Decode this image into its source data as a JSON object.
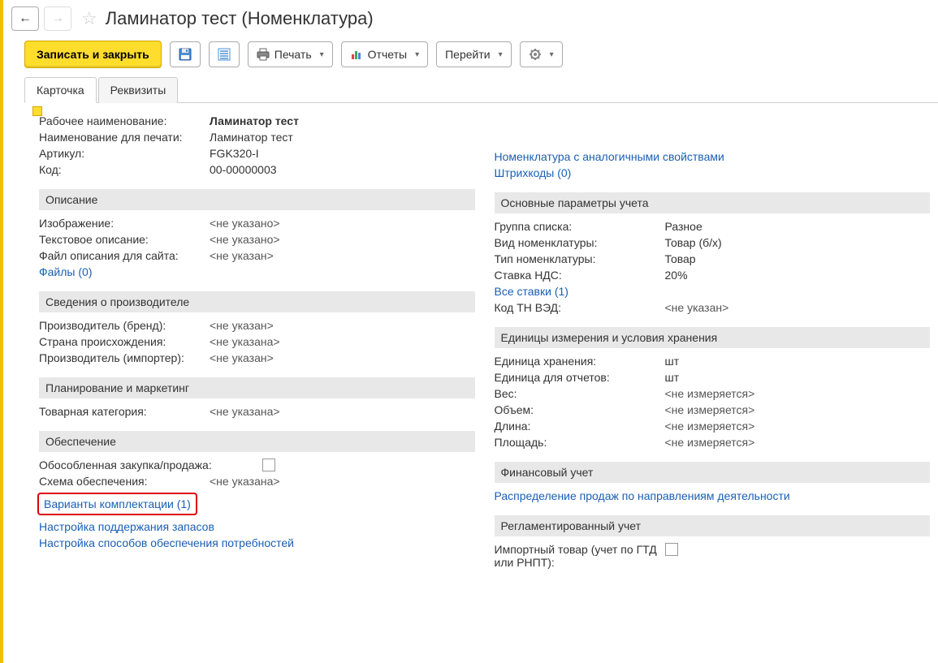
{
  "title": "Ламинатор тест (Номенклатура)",
  "toolbar": {
    "save_close": "Записать и закрыть",
    "print": "Печать",
    "reports": "Отчеты",
    "goto": "Перейти"
  },
  "tabs": {
    "card": "Карточка",
    "props": "Реквизиты"
  },
  "left": {
    "working_name_label": "Рабочее наименование:",
    "working_name": "Ламинатор тест",
    "print_name_label": "Наименование для печати:",
    "print_name": "Ламинатор тест",
    "article_label": "Артикул:",
    "article": "FGK320-I",
    "code_label": "Код:",
    "code": "00-00000003",
    "desc_header": "Описание",
    "image_label": "Изображение:",
    "image_val": "<не указано>",
    "text_desc_label": "Текстовое описание:",
    "text_desc_val": "<не указано>",
    "site_file_label": "Файл описания для сайта:",
    "site_file_val": "<не указан>",
    "files_link": "Файлы (0)",
    "manuf_header": "Сведения о производителе",
    "brand_label": "Производитель (бренд):",
    "brand_val": "<не указан>",
    "origin_label": "Страна происхождения:",
    "origin_val": "<не указана>",
    "importer_label": "Производитель (импортер):",
    "importer_val": "<не указан>",
    "planning_header": "Планирование и маркетинг",
    "cat_label": "Товарная категория:",
    "cat_val": "<не указана>",
    "supply_header": "Обеспечение",
    "separate_label": "Обособленная закупка/продажа:",
    "scheme_label": "Схема обеспечения:",
    "scheme_val": "<не указана>",
    "variants_link": "Варианты комплектации (1)",
    "stock_link": "Настройка поддержания запасов",
    "methods_link": "Настройка способов обеспечения потребностей"
  },
  "right": {
    "analog_link": "Номенклатура с аналогичными свойствами",
    "barcodes_link": "Штрихкоды (0)",
    "params_header": "Основные параметры учета",
    "group_label": "Группа списка:",
    "group_val": "Разное",
    "kind_label": "Вид номенклатуры:",
    "kind_val": "Товар (б/х)",
    "type_label": "Тип номенклатуры:",
    "type_val": "Товар",
    "vat_label": "Ставка НДС:",
    "vat_val": "20%",
    "all_rates_link": "Все ставки (1)",
    "tnved_label": "Код ТН ВЭД:",
    "tnved_val": "<не указан>",
    "units_header": "Единицы измерения и условия хранения",
    "store_unit_label": "Единица хранения:",
    "store_unit_val": "шт",
    "report_unit_label": "Единица для отчетов:",
    "report_unit_val": "шт",
    "weight_label": "Вес:",
    "weight_val": "<не измеряется>",
    "volume_label": "Объем:",
    "volume_val": "<не измеряется>",
    "length_label": "Длина:",
    "length_val": "<не измеряется>",
    "area_label": "Площадь:",
    "area_val": "<не измеряется>",
    "fin_header": "Финансовый учет",
    "sales_dist_link": "Распределение продаж по направлениям деятельности",
    "reg_header": "Регламентированный учет",
    "import_label": "Импортный товар (учет по ГТД или РНПТ):"
  }
}
